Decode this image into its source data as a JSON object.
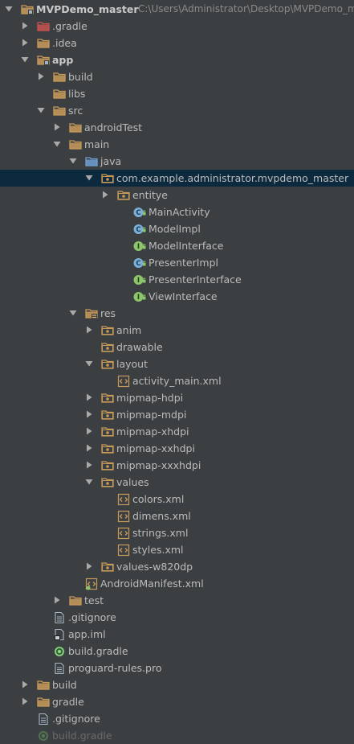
{
  "project_tree": {
    "rows": [
      {
        "label": "MVPDemo_master",
        "path": "C:\\Users\\Administrator\\Desktop\\MVPDemo_ma",
        "icon": "module-folder-icon",
        "arrow": "down",
        "depth": 0,
        "bold": true
      },
      {
        "label": ".gradle",
        "icon": "folder-excluded-icon",
        "arrow": "right",
        "depth": 1
      },
      {
        "label": ".idea",
        "icon": "folder-icon",
        "arrow": "right",
        "depth": 1
      },
      {
        "label": "app",
        "icon": "module-folder-icon",
        "arrow": "down",
        "depth": 1,
        "bold": true
      },
      {
        "label": "build",
        "icon": "folder-icon",
        "arrow": "right",
        "depth": 2
      },
      {
        "label": "libs",
        "icon": "folder-icon",
        "arrow": "none",
        "depth": 2
      },
      {
        "label": "src",
        "icon": "folder-icon",
        "arrow": "down",
        "depth": 2
      },
      {
        "label": "androidTest",
        "icon": "folder-icon",
        "arrow": "right",
        "depth": 3
      },
      {
        "label": "main",
        "icon": "folder-icon",
        "arrow": "down",
        "depth": 3
      },
      {
        "label": "java",
        "icon": "source-folder-icon",
        "arrow": "down",
        "depth": 4
      },
      {
        "label": "com.example.administrator.mvpdemo_master",
        "icon": "package-icon",
        "arrow": "down",
        "depth": 5,
        "selected": true
      },
      {
        "label": "entitye",
        "icon": "package-icon",
        "arrow": "right",
        "depth": 6
      },
      {
        "label": "MainActivity",
        "icon": "class-icon",
        "arrow": "none",
        "depth": 7
      },
      {
        "label": "ModelImpl",
        "icon": "class-icon",
        "arrow": "none",
        "depth": 7
      },
      {
        "label": "ModelInterface",
        "icon": "interface-icon",
        "arrow": "none",
        "depth": 7
      },
      {
        "label": "PresenterImpl",
        "icon": "class-icon",
        "arrow": "none",
        "depth": 7
      },
      {
        "label": "PresenterInterface",
        "icon": "interface-icon",
        "arrow": "none",
        "depth": 7
      },
      {
        "label": "ViewInterface",
        "icon": "interface-icon",
        "arrow": "none",
        "depth": 7
      },
      {
        "label": "res",
        "icon": "resource-folder-icon",
        "arrow": "down",
        "depth": 4
      },
      {
        "label": "anim",
        "icon": "package-icon",
        "arrow": "right",
        "depth": 5
      },
      {
        "label": "drawable",
        "icon": "package-icon",
        "arrow": "none",
        "depth": 5
      },
      {
        "label": "layout",
        "icon": "package-icon",
        "arrow": "down",
        "depth": 5
      },
      {
        "label": "activity_main.xml",
        "icon": "xml-file-icon",
        "arrow": "none",
        "depth": 6
      },
      {
        "label": "mipmap-hdpi",
        "icon": "package-icon",
        "arrow": "right",
        "depth": 5
      },
      {
        "label": "mipmap-mdpi",
        "icon": "package-icon",
        "arrow": "right",
        "depth": 5
      },
      {
        "label": "mipmap-xhdpi",
        "icon": "package-icon",
        "arrow": "right",
        "depth": 5
      },
      {
        "label": "mipmap-xxhdpi",
        "icon": "package-icon",
        "arrow": "right",
        "depth": 5
      },
      {
        "label": "mipmap-xxxhdpi",
        "icon": "package-icon",
        "arrow": "right",
        "depth": 5
      },
      {
        "label": "values",
        "icon": "package-icon",
        "arrow": "down",
        "depth": 5
      },
      {
        "label": "colors.xml",
        "icon": "xml-file-icon",
        "arrow": "none",
        "depth": 6
      },
      {
        "label": "dimens.xml",
        "icon": "xml-file-icon",
        "arrow": "none",
        "depth": 6
      },
      {
        "label": "strings.xml",
        "icon": "xml-file-icon",
        "arrow": "none",
        "depth": 6
      },
      {
        "label": "styles.xml",
        "icon": "xml-file-icon",
        "arrow": "none",
        "depth": 6
      },
      {
        "label": "values-w820dp",
        "icon": "package-icon",
        "arrow": "right",
        "depth": 5
      },
      {
        "label": "AndroidManifest.xml",
        "icon": "manifest-file-icon",
        "arrow": "none",
        "depth": 4
      },
      {
        "label": "test",
        "icon": "folder-icon",
        "arrow": "right",
        "depth": 3
      },
      {
        "label": ".gitignore",
        "icon": "text-file-icon",
        "arrow": "none",
        "depth": 2
      },
      {
        "label": "app.iml",
        "icon": "iml-file-icon",
        "arrow": "none",
        "depth": 2
      },
      {
        "label": "build.gradle",
        "icon": "gradle-file-icon",
        "arrow": "none",
        "depth": 2
      },
      {
        "label": "proguard-rules.pro",
        "icon": "text-file-icon",
        "arrow": "none",
        "depth": 2
      },
      {
        "label": "build",
        "icon": "folder-icon",
        "arrow": "right",
        "depth": 1
      },
      {
        "label": "gradle",
        "icon": "folder-icon",
        "arrow": "right",
        "depth": 1
      },
      {
        "label": ".gitignore",
        "icon": "text-file-icon",
        "arrow": "none",
        "depth": 1
      },
      {
        "label": "build.gradle",
        "icon": "gradle-file-icon",
        "arrow": "none",
        "depth": 1,
        "partial": true
      }
    ]
  },
  "colors": {
    "background": "#3c3f41",
    "selection": "#0d293e",
    "text": "#bbbbbb",
    "folder": "#c89a5a",
    "class_badge": "#7ab0d8",
    "interface_badge": "#8dc56c",
    "excluded_folder": "#c75450"
  }
}
